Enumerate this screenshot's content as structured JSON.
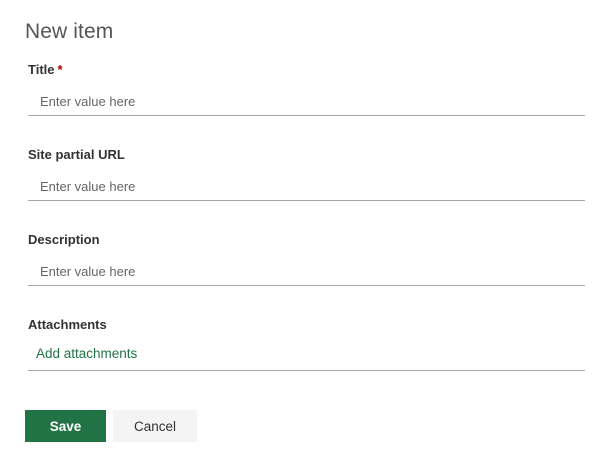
{
  "form": {
    "title": "New item"
  },
  "fields": [
    {
      "label": "Title",
      "required_mark": "*",
      "value": "",
      "placeholder": "Enter value here"
    },
    {
      "label": "Site partial URL",
      "value": "",
      "placeholder": "Enter value here"
    },
    {
      "label": "Description",
      "value": "",
      "placeholder": "Enter value here"
    }
  ],
  "attachments": {
    "label": "Attachments",
    "link_text": "Add attachments"
  },
  "actions": {
    "save_label": "Save",
    "cancel_label": "Cancel"
  },
  "colors": {
    "accent": "#217346",
    "required": "#a80000",
    "cancel_bg": "#f4f4f4"
  }
}
